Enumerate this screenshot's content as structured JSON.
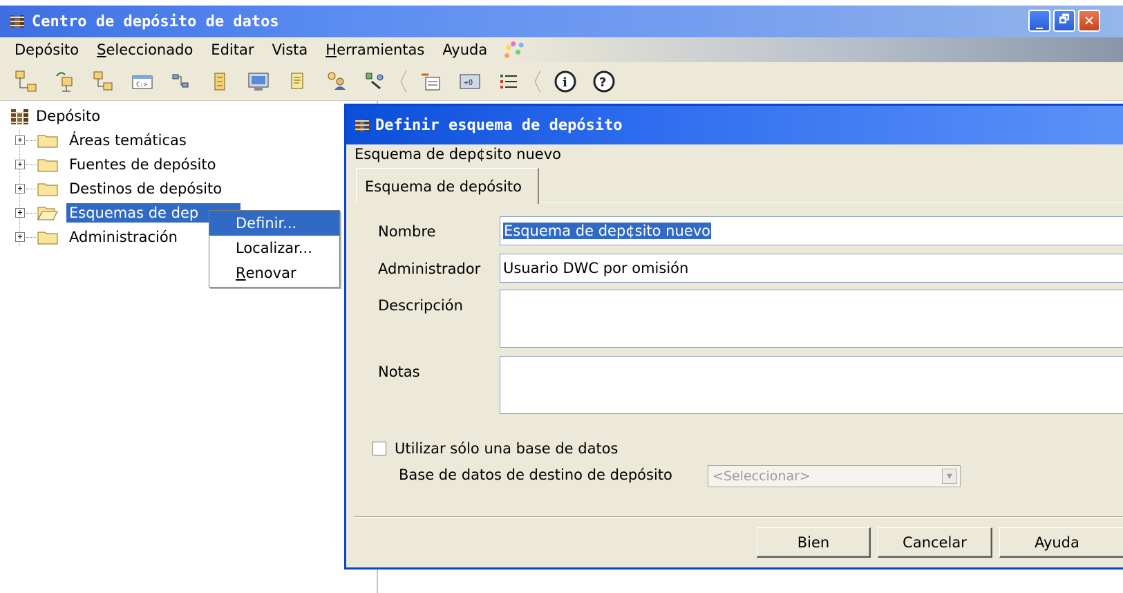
{
  "window": {
    "title": "Centro de depósito de datos",
    "controls": {
      "minimize": "_",
      "maximize": "🗗",
      "close": "✕"
    }
  },
  "menubar": {
    "items": [
      {
        "label_u": "",
        "label_rest": "Depósito"
      },
      {
        "label_u": "S",
        "label_rest": "eleccionado"
      },
      {
        "label_u": "",
        "label_rest": "Editar"
      },
      {
        "label_u": "",
        "label_rest": "Vista"
      },
      {
        "label_u": "H",
        "label_rest": "erramientas"
      },
      {
        "label_u": "",
        "label_rest": "Ayuda"
      }
    ]
  },
  "toolbar": {
    "icons": [
      "tree-view-icon",
      "sources-icon",
      "targets-icon",
      "command-prompt-icon",
      "process-icon",
      "database-icon",
      "monitor-icon",
      "notes-icon",
      "users-icon",
      "agents-icon",
      "send-message-icon",
      "transform-icon",
      "list-icon",
      "info-icon",
      "help-icon"
    ]
  },
  "tree": {
    "root": "Depósito",
    "items": [
      {
        "label": "Áreas temáticas",
        "selected": false
      },
      {
        "label": "Fuentes de depósito",
        "selected": false
      },
      {
        "label": "Destinos de depósito",
        "selected": false
      },
      {
        "label": "Esquemas de dep",
        "selected": true
      },
      {
        "label": "Administración",
        "selected": false
      }
    ]
  },
  "context_menu": {
    "define": "Definir...",
    "locate": "Localizar...",
    "refresh_u": "R",
    "refresh_rest": "enovar"
  },
  "dialog": {
    "title": "Definir esquema de depósito",
    "subtitle": "Esquema de dep¢sito nuevo",
    "tab": "Esquema de depósito",
    "fields": {
      "name_label": "Nombre",
      "name_value": "Esquema de dep¢sito nuevo",
      "admin_label": "Administrador",
      "admin_value": "Usuario DWC por omisión",
      "description_label": "Descripción",
      "description_value": "",
      "notes_label": "Notas",
      "notes_value": ""
    },
    "single_db_checkbox": "Utilizar sólo una base de datos",
    "single_db_checked": false,
    "target_db_label": "Base de datos de destino de depósito",
    "target_db_placeholder": "<Seleccionar>",
    "buttons": {
      "ok": "Bien",
      "cancel": "Cancelar",
      "help": "Ayuda"
    }
  },
  "colors": {
    "title_blue": "#3d6fe3",
    "dialog_title_blue": "#0b4ed8",
    "selection": "#316ac5",
    "face": "#ece9d8",
    "close_red": "#c8431c"
  }
}
